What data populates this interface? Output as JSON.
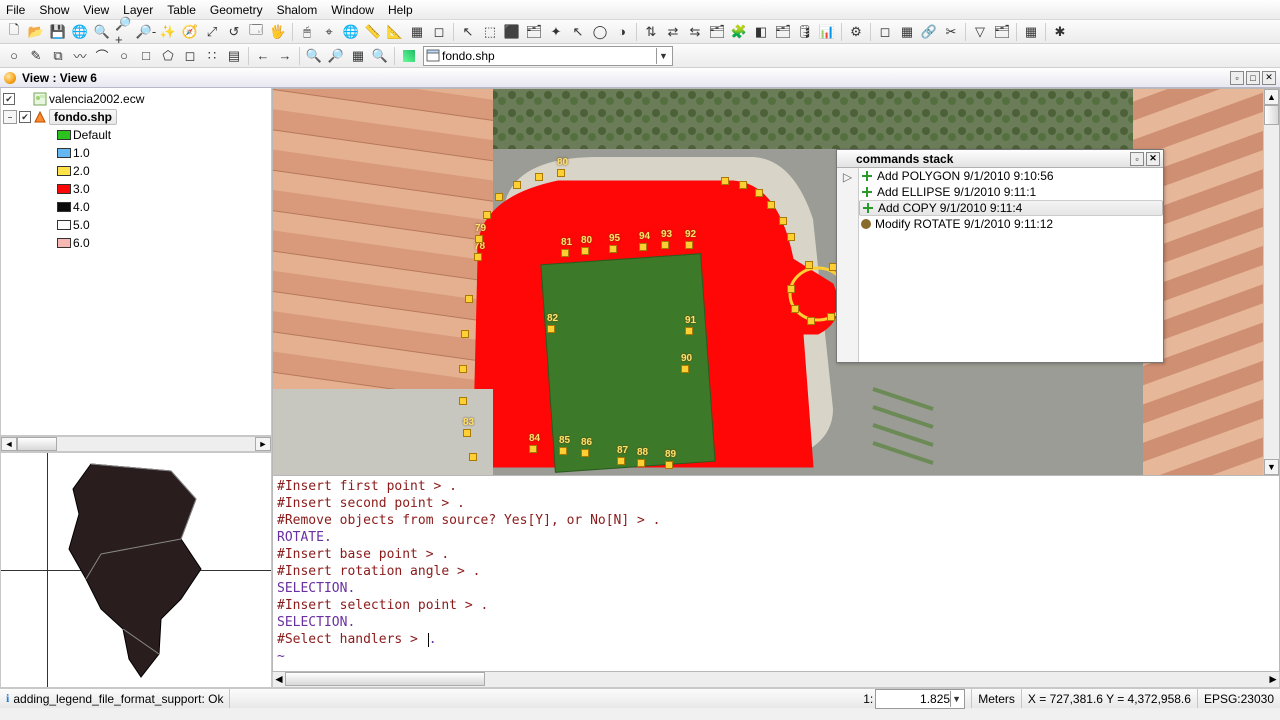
{
  "menu": [
    "File",
    "Show",
    "View",
    "Layer",
    "Table",
    "Geometry",
    "Shalom",
    "Window",
    "Help"
  ],
  "view_title": "View : View 6",
  "active_layer_combo": "fondo.shp",
  "toc": {
    "layers": [
      {
        "checked": true,
        "name": "valencia2002.ecw",
        "type": "raster"
      },
      {
        "checked": true,
        "name": "fondo.shp",
        "type": "vector",
        "selected": true
      }
    ],
    "legend": [
      {
        "color": "#2bc21e",
        "label": "Default"
      },
      {
        "color": "#64b8ef",
        "label": "1.0"
      },
      {
        "color": "#ffe24a",
        "label": "2.0"
      },
      {
        "color": "#ff0707",
        "label": "3.0"
      },
      {
        "color": "#0a0a0a",
        "label": "4.0"
      },
      {
        "color": "#ffffff",
        "label": "5.0"
      },
      {
        "color": "#f6b8b0",
        "label": "6.0"
      }
    ]
  },
  "commands_stack": {
    "title": "commands stack",
    "items": [
      {
        "icon": "plus",
        "text": "Add POLYGON 9/1/2010 9:10:56"
      },
      {
        "icon": "plus",
        "text": "Add ELLIPSE 9/1/2010 9:11:1"
      },
      {
        "icon": "plus",
        "text": "Add COPY 9/1/2010 9:11:4",
        "selected": true
      },
      {
        "icon": "dot",
        "text": "Modify ROTATE 9/1/2010 9:11:12"
      }
    ]
  },
  "console_lines": [
    {
      "kind": "p",
      "text": "#Insert first point > ."
    },
    {
      "kind": "p",
      "text": "#Insert second point > ."
    },
    {
      "kind": "p",
      "text": "#Remove objects from source? Yes[Y], or No[N] > ."
    },
    {
      "kind": "c",
      "text": "ROTATE."
    },
    {
      "kind": "p",
      "text": "#Insert base point > ."
    },
    {
      "kind": "p",
      "text": "#Insert rotation angle > ."
    },
    {
      "kind": "c",
      "text": "SELECTION."
    },
    {
      "kind": "p",
      "text": "#Insert selection point > ."
    },
    {
      "kind": "c",
      "text": "SELECTION."
    },
    {
      "kind": "p",
      "text": "#Select handlers > ",
      "caret": true,
      "trail": "."
    }
  ],
  "status": {
    "left": "adding_legend_file_format_support: Ok",
    "scale_prefix": "1:",
    "scale_value": "1.825",
    "units": "Meters",
    "coords": "X = 727,381.6   Y = 4,372,958.6",
    "epsg": "EPSG:23030"
  },
  "toolbar_icons_row1": [
    "🗋",
    "📂",
    "💾",
    "🌐",
    "🔍",
    "🔎+",
    "🔎-",
    "✨",
    "🧭",
    "⤢",
    "↺",
    "🗔",
    "🖐",
    "│",
    "🖱",
    "⌖",
    "🌐",
    "📏",
    "📐",
    "▦",
    "◻",
    "│",
    "↖",
    "⬚",
    "⬛",
    "🗂",
    "✦",
    "↖",
    "◯",
    "◑",
    "│",
    "⇅",
    "⇄",
    "⇆",
    "🗂",
    "🧩",
    "◧",
    "🗂",
    "🛢",
    "📊",
    "│",
    "⚙",
    "│",
    "◻",
    "▦",
    "🔗",
    "✂",
    "│",
    "▽",
    "🗂",
    "│",
    "▦",
    "│",
    "✱"
  ],
  "toolbar_icons_row2a": [
    "○",
    "✎",
    "⧉",
    "〰",
    "⌒",
    "○",
    "□",
    "⬠",
    "◻",
    "∷",
    "▤"
  ],
  "toolbar_icons_row2b": [
    "←",
    "→"
  ],
  "toolbar_icons_row2c": [
    "🔍",
    "🔎",
    "▦",
    "🔍"
  ]
}
